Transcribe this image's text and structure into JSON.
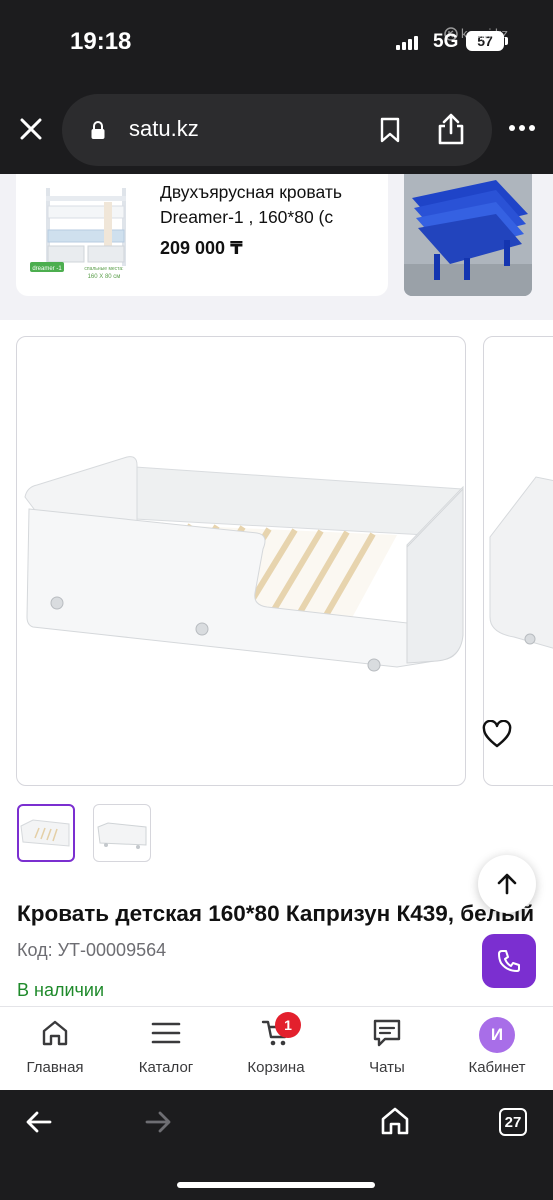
{
  "status_bar": {
    "time": "19:18",
    "network": "5G",
    "battery": "57",
    "watermark": "kaspi.kz"
  },
  "browser": {
    "url": "satu.kz",
    "tab_count": "27"
  },
  "recommendation": {
    "title": "Двухъярусная кровать Dreamer-1 , 160*80 (с",
    "price": "209 000 ₸",
    "thumb_badge": "dreamer -1",
    "thumb_caption_1": "спальные места:",
    "thumb_caption_2": "160 X 80 см"
  },
  "product": {
    "title": "Кровать детская 160*80 Капризун К439, белый",
    "code": "Код: УТ-00009564",
    "availability": "В наличии"
  },
  "tab_bar": {
    "items": [
      {
        "label": "Главная",
        "icon": "home-icon"
      },
      {
        "label": "Каталог",
        "icon": "menu-icon"
      },
      {
        "label": "Корзина",
        "icon": "cart-icon"
      },
      {
        "label": "Чаты",
        "icon": "chat-icon"
      },
      {
        "label": "Кабинет",
        "icon": "avatar"
      }
    ],
    "cart_badge": "1",
    "avatar_letter": "И"
  },
  "colors": {
    "accent": "#7b2fd0",
    "in_stock": "#1f8a2b",
    "badge": "#e3202d",
    "chrome": "#1c1c1e"
  }
}
